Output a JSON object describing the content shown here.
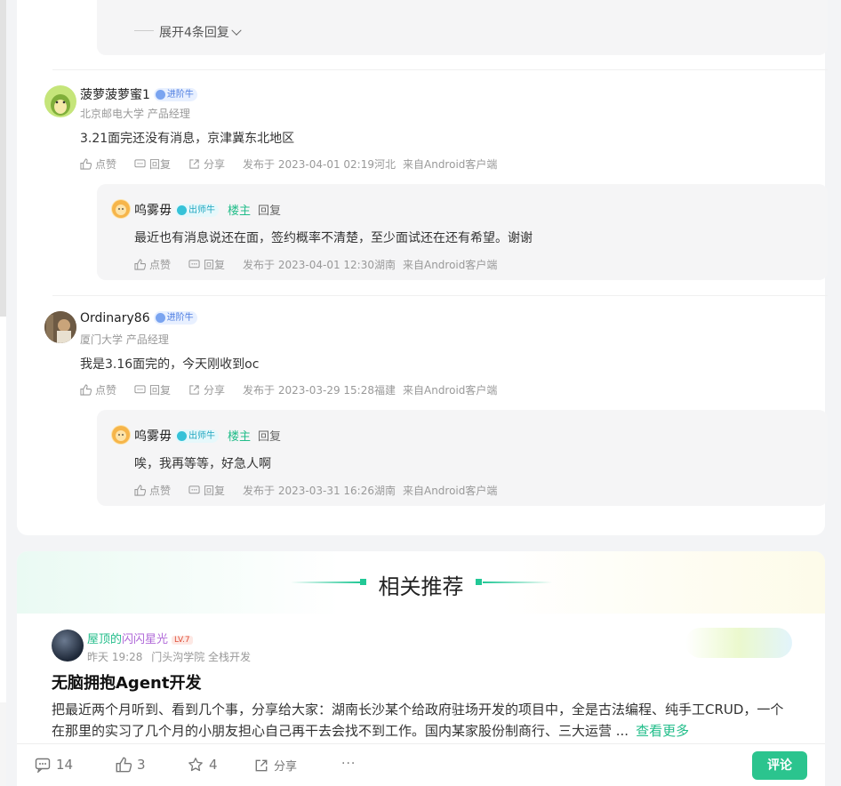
{
  "thread": {
    "expand_label": "展开4条回复"
  },
  "comments": [
    {
      "username": "菠萝菠萝蜜1",
      "badge": "进阶牛",
      "org": "北京邮电大学 产品经理",
      "text": "3.21面完还没有消息，京津冀东北地区",
      "like": "点赞",
      "reply": "回复",
      "share": "分享",
      "published": "发布于 2023-04-01 02:19河北",
      "client": "来自Android客户端",
      "sub_reply": {
        "username": "呜雾毋",
        "badge": "出师牛",
        "owner_tag": "楼主",
        "reply_label": "回复",
        "text": "最近也有消息说还在面，签约概率不清楚，至少面试还在还有希望。谢谢",
        "like": "点赞",
        "reply": "回复",
        "published": "发布于 2023-04-01 12:30湖南",
        "client": "来自Android客户端"
      }
    },
    {
      "username": "Ordinary86",
      "badge": "进阶牛",
      "org": "厦门大学 产品经理",
      "text": "我是3.16面完的，今天刚收到oc",
      "like": "点赞",
      "reply": "回复",
      "share": "分享",
      "published": "发布于 2023-03-29 15:28福建",
      "client": "来自Android客户端",
      "sub_reply": {
        "username": "呜雾毋",
        "badge": "出师牛",
        "owner_tag": "楼主",
        "reply_label": "回复",
        "text": "唉，我再等等，好急人啊",
        "like": "点赞",
        "reply": "回复",
        "published": "发布于 2023-03-31 16:26湖南",
        "client": "来自Android客户端"
      }
    }
  ],
  "recommend": {
    "heading": "相关推荐",
    "post": {
      "author_part1": "屋顶的",
      "author_part2": "闪闪星光",
      "level": "LV.7",
      "time": "昨天 19:28",
      "school": "门头沟学院 全栈开发",
      "title": "无脑拥抱Agent开发",
      "body": "把最近两个月听到、看到几个事，分享给大家：湖南长沙某个给政府驻场开发的项目中，全是古法编程、纯手工CRUD，一个在那里的实习了几个月的小朋友担心自己再干去会找不到工作。国内某家股份制商行、三大运营 ...",
      "more": "查看更多"
    }
  },
  "bottom_bar": {
    "comments": "14",
    "likes": "3",
    "favorites": "4",
    "share": "分享",
    "more": "···",
    "comment_button": "评论"
  },
  "colors": {
    "accent": "#22bd8a",
    "button": "#2bc48e"
  }
}
